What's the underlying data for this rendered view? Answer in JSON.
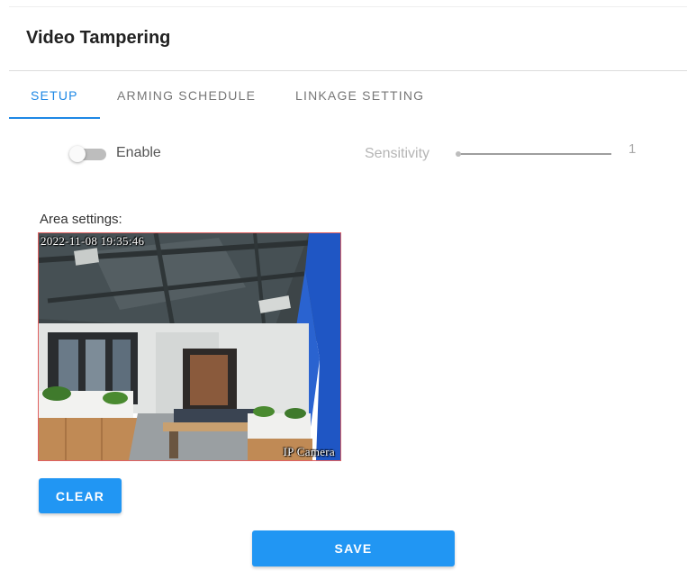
{
  "page": {
    "title": "Video Tampering"
  },
  "tabs": [
    {
      "label": "SETUP",
      "active": true
    },
    {
      "label": "ARMING SCHEDULE",
      "active": false
    },
    {
      "label": "LINKAGE SETTING",
      "active": false
    }
  ],
  "setup": {
    "enable": {
      "label": "Enable",
      "checked": false
    },
    "sensitivity": {
      "label": "Sensitivity",
      "value": "1"
    },
    "area": {
      "label": "Area settings:"
    },
    "preview": {
      "timestamp": "2022-11-08 19:35:46",
      "camera_name": "IP Camera"
    },
    "clear_label": "CLEAR",
    "save_label": "SAVE"
  },
  "colors": {
    "accent": "#2196f3",
    "active_tab": "#1e88e5",
    "area_border": "#e06060"
  }
}
